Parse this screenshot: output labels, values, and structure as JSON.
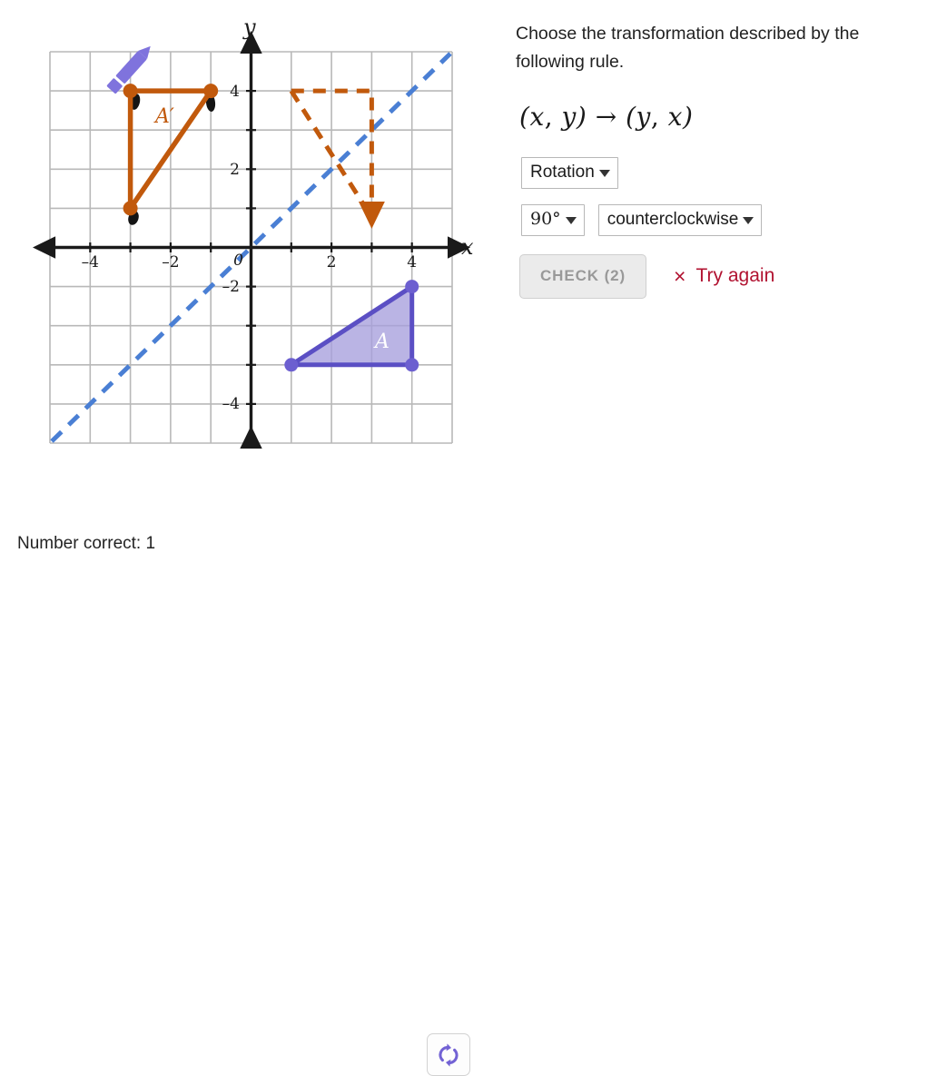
{
  "prompt": {
    "text": "Choose the transformation described by the following rule.",
    "rule_plain": "(x, y) → (y, x)",
    "rule_parts": {
      "open1": "(",
      "x1": "x",
      "comma1": ", ",
      "y1": "y",
      "close1": ")",
      "arrow": " → ",
      "open2": "(",
      "y2": "y",
      "comma2": ", ",
      "x2": "x",
      "close2": ")"
    }
  },
  "controls": {
    "transformation": {
      "label": "Rotation",
      "icon": "chevron-down-icon"
    },
    "angle": {
      "label": "90°",
      "icon": "chevron-down-icon"
    },
    "direction": {
      "label": "counterclockwise",
      "icon": "chevron-down-icon"
    },
    "check_button": {
      "label": "CHECK (2)",
      "attempts": 2,
      "disabled": true
    },
    "feedback": {
      "mark": "×",
      "text": "Try again",
      "color": "#b11230",
      "state": "incorrect"
    }
  },
  "footer": {
    "score_label": "Number correct: 1",
    "score_value": 1,
    "reset_button": {
      "icon": "refresh-icon",
      "color": "#7262d4"
    }
  },
  "chart_data": {
    "type": "scatter",
    "title": "",
    "xlabel": "x",
    "ylabel": "y",
    "xlim": [
      -5,
      5
    ],
    "ylim": [
      -5,
      5
    ],
    "xticks": [
      -4,
      -2,
      2,
      4
    ],
    "yticks": [
      4,
      2,
      -2,
      -4
    ],
    "origin_label": "0",
    "xtick_labels": [
      "–4",
      "–2",
      "2",
      "4"
    ],
    "ytick_labels": [
      "4",
      "2",
      "–2",
      "–4"
    ],
    "grid": true,
    "grid_step": 1,
    "grid_color": "#b5b5b5",
    "axis_color": "#1a1a1a",
    "legend": "none",
    "series": [
      {
        "name": "Preimage triangle A",
        "type": "polygon",
        "label": "A",
        "label_position": [
          3.1,
          -2.1
        ],
        "color": "#5b4fc4",
        "fill": "#a79fdd",
        "fill_opacity": 0.75,
        "style": "solid",
        "vertices": [
          [
            1,
            -3
          ],
          [
            4,
            -3
          ],
          [
            4,
            -1
          ]
        ],
        "vertex_markers": true
      },
      {
        "name": "Image triangle A-prime",
        "type": "polygon",
        "label": "A'",
        "label_position": [
          -2.35,
          3.1
        ],
        "color": "#c1590c",
        "fill": "none",
        "style": "solid",
        "vertices": [
          [
            -3,
            4
          ],
          [
            -1,
            4
          ],
          [
            -3,
            1
          ]
        ],
        "vertex_markers": true
      },
      {
        "name": "Correct answer outline",
        "type": "polygon",
        "label": "",
        "color": "#c1590c",
        "fill": "none",
        "style": "dashed",
        "vertices": [
          [
            1,
            4
          ],
          [
            3,
            4
          ],
          [
            3,
            1
          ]
        ],
        "vertex_markers": false
      },
      {
        "name": "Line of reflection y equals x",
        "type": "line",
        "label": "",
        "color": "#4a7fd4",
        "style": "dashed",
        "points": [
          [
            -5,
            -5
          ],
          [
            5,
            5
          ]
        ]
      }
    ],
    "cursor": {
      "name": "pencil-cursor",
      "color": "#7262d4",
      "position": [
        -2.7,
        4.55
      ]
    }
  }
}
